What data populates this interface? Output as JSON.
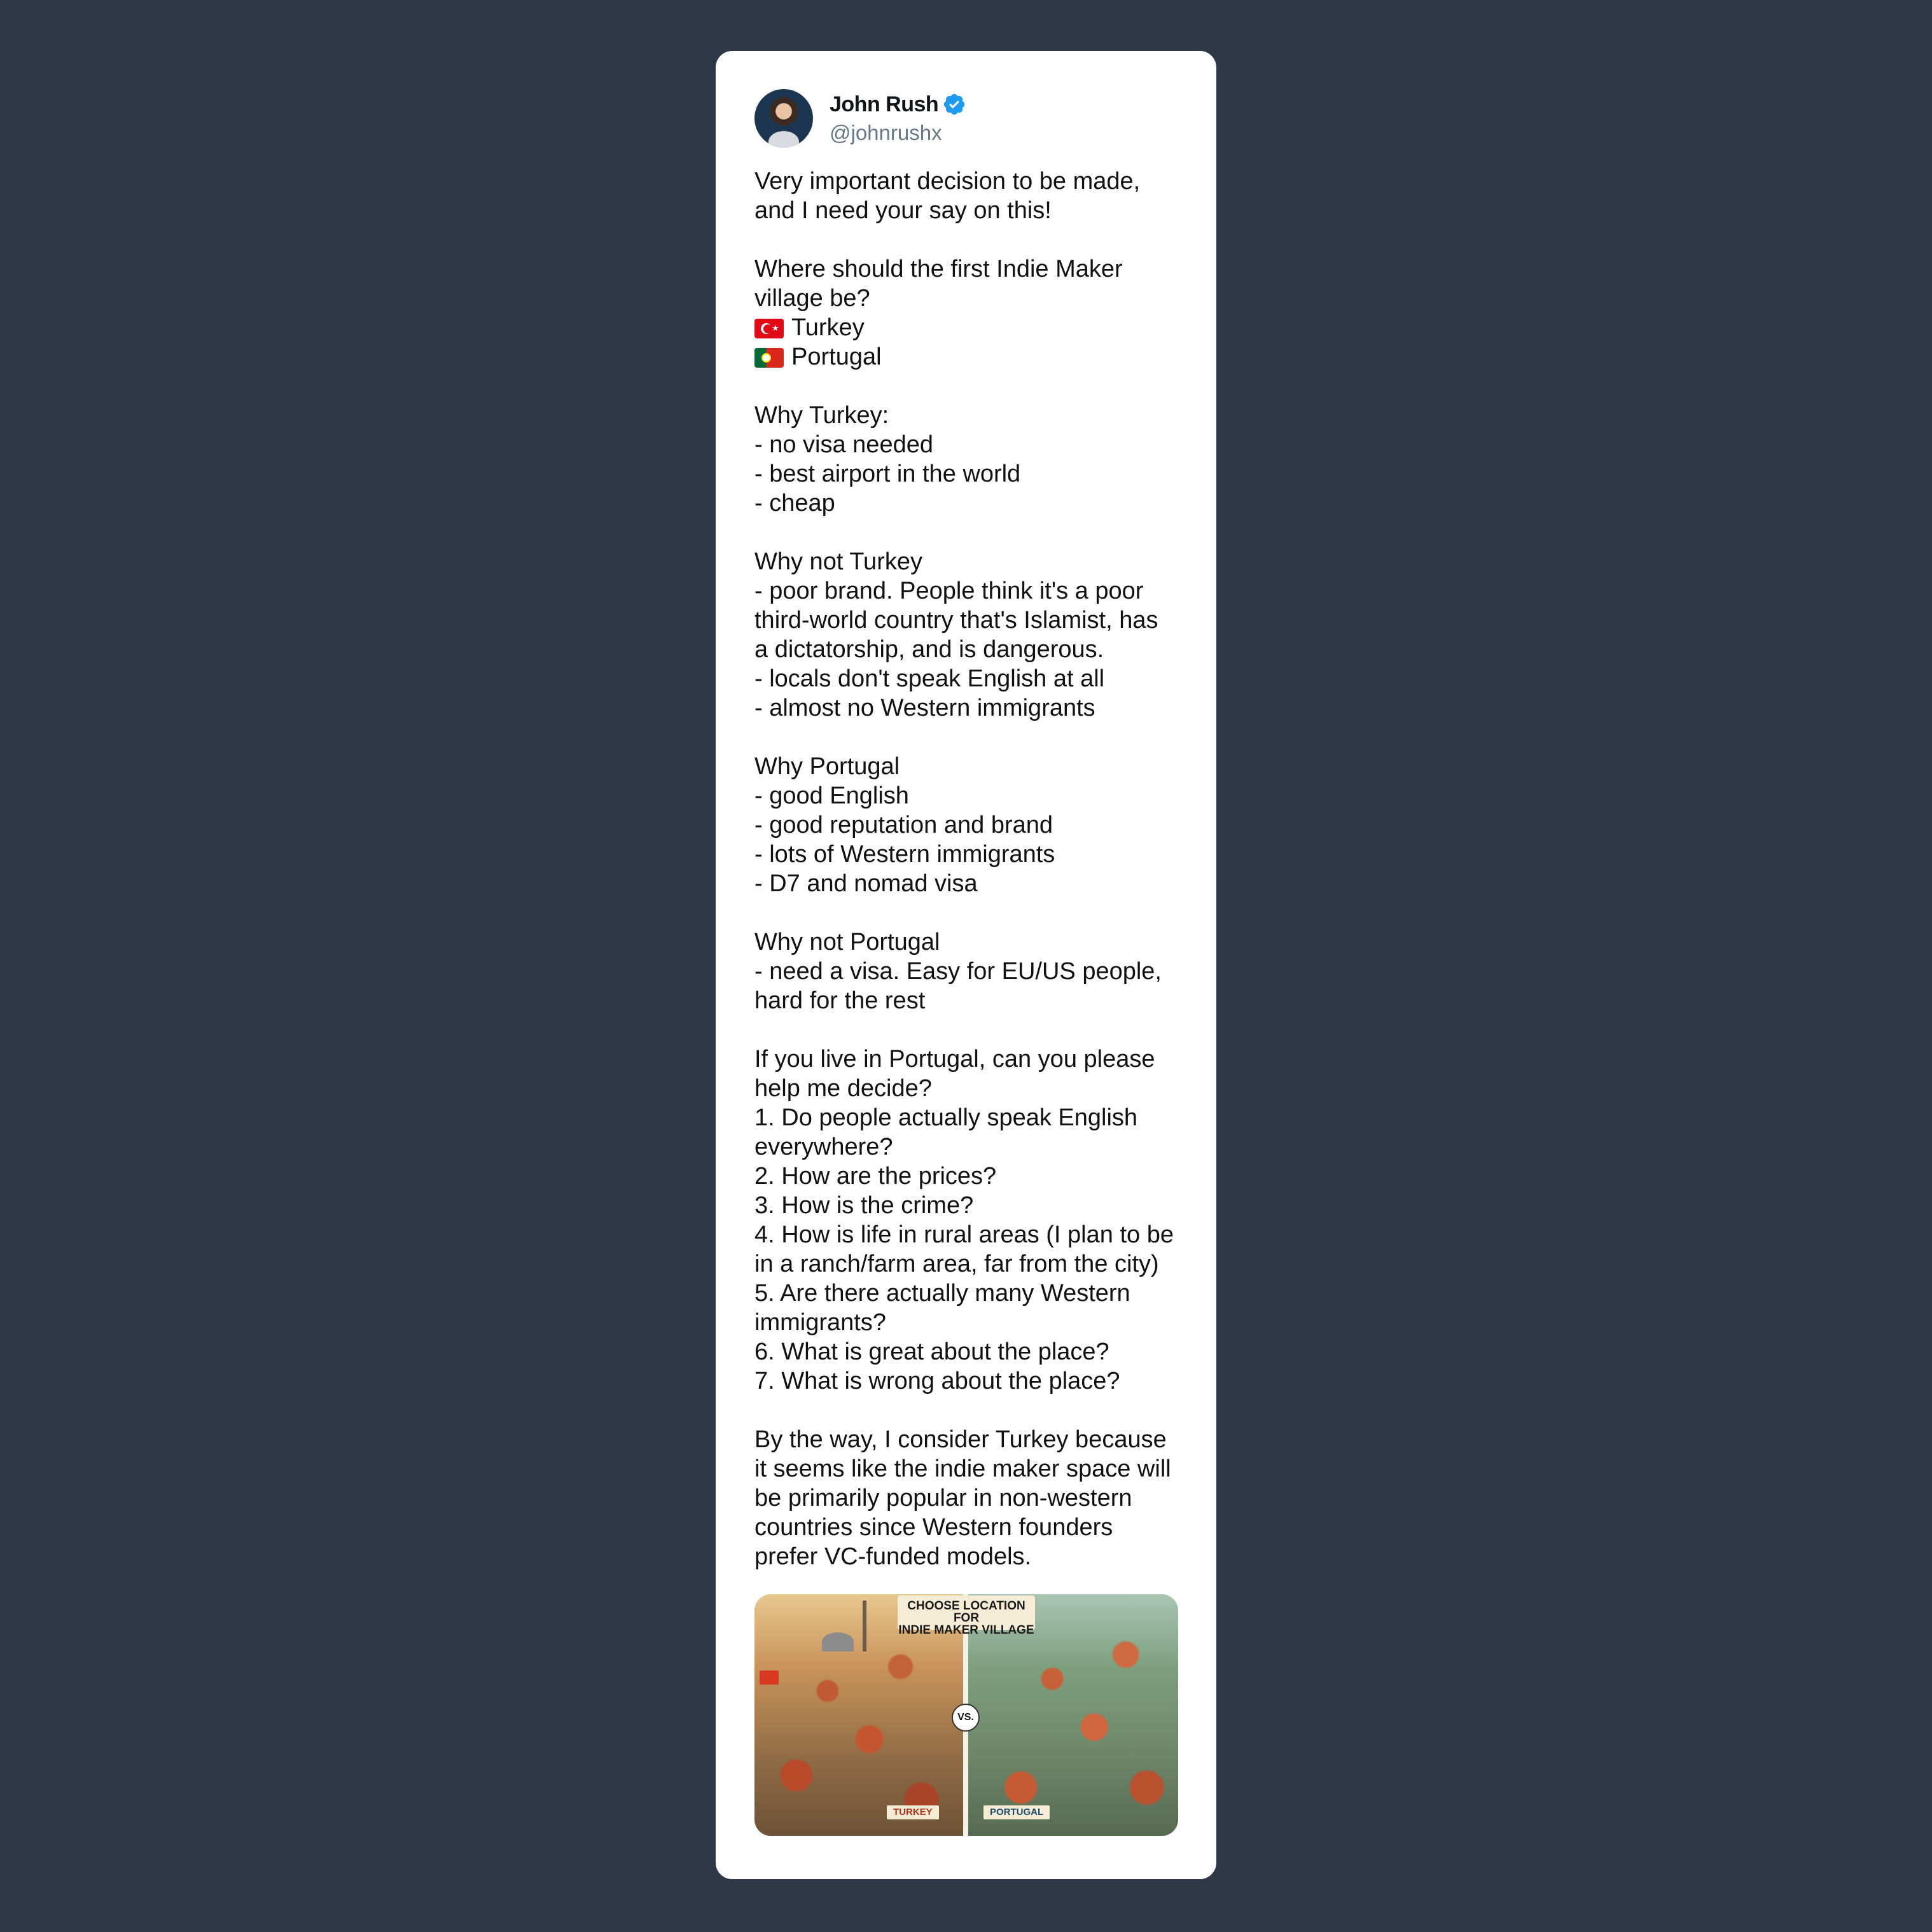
{
  "author": {
    "display_name": "John Rush",
    "handle": "@johnrushx",
    "verified_icon": "verified-badge-icon",
    "verified_color": "#1d9bf0"
  },
  "tweet": {
    "lines": [
      "Very important decision to be made,",
      "and I need your say on this!",
      "",
      "Where should the first Indie Maker",
      "village be?",
      "Turkey",
      "Portugal",
      "",
      "Why Turkey:",
      "- no visa needed",
      "- best airport in the world",
      "- cheap",
      "",
      "Why not Turkey",
      "- poor brand. People think it's a poor",
      "third-world country that's Islamist, has",
      "a dictatorship, and is dangerous.",
      "- locals don't speak English at all",
      "- almost no Western immigrants",
      "",
      "Why Portugal",
      "- good English",
      "- good reputation and brand",
      "- lots of Western immigrants",
      "- D7 and nomad visa",
      "",
      "Why not Portugal",
      "- need a visa. Easy for EU/US people,",
      "hard for the rest",
      "",
      "If you live in Portugal, can you please",
      "help me decide?",
      "1. Do people actually speak English",
      "everywhere?",
      "2. How are the prices?",
      "3. How is the crime?",
      "4. How is life in rural areas (I plan to be",
      "in a ranch/farm area, far from the city)",
      "5. Are there actually many Western",
      "immigrants?",
      "6. What is great about the place?",
      "7. What is wrong about the place?",
      "",
      "By the way, I consider Turkey because",
      "it seems like the indie maker space will",
      "be primarily popular in non-western",
      "countries since Western founders",
      "prefer VC-funded models."
    ],
    "flag_icons": {
      "turkey": "turkey-flag-icon",
      "portugal": "portugal-flag-icon"
    }
  },
  "media": {
    "banner_line1": "CHOOSE LOCATION FOR",
    "banner_line2": "INDIE MAKER VILLAGE",
    "vs_label": "VS.",
    "left_label": "TURKEY",
    "right_label": "PORTUGAL"
  },
  "colors": {
    "page_background": "#2e3748",
    "card_background": "#ffffff",
    "text": "#111111",
    "handle": "#66788a"
  }
}
